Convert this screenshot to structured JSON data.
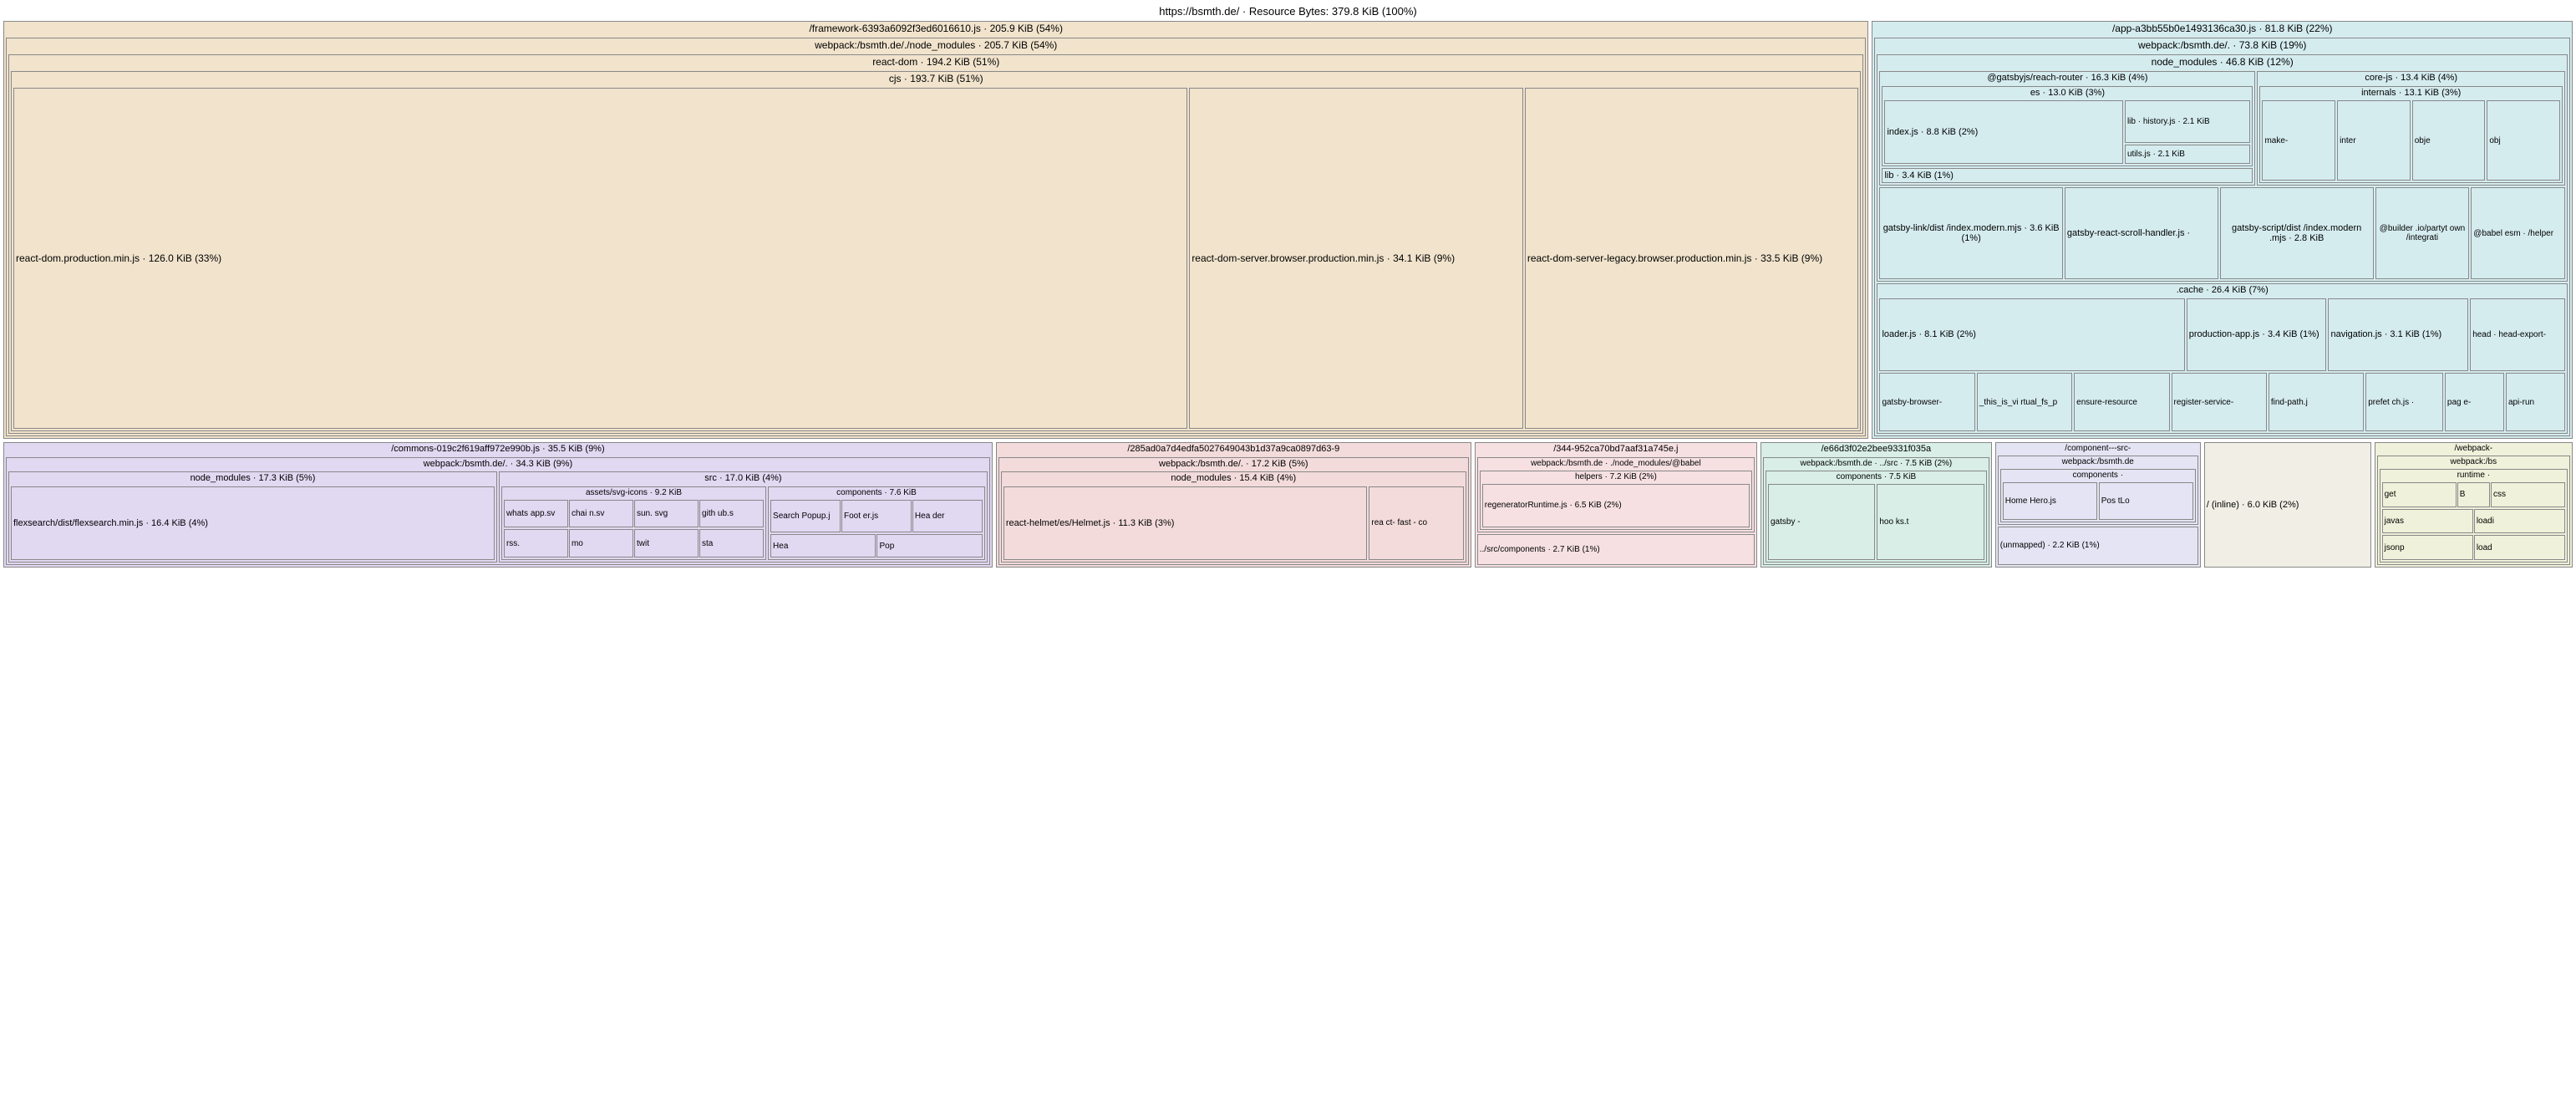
{
  "root_title": "https://bsmth.de/ · Resource Bytes: 379.8 KiB (100%)",
  "framework": {
    "title": "/framework-6393a6092f3ed6016610.js · 205.9 KiB (54%)",
    "webpack": "webpack:/bsmth.de/./node_modules · 205.7 KiB (54%)",
    "react_dom": "react-dom · 194.2 KiB (51%)",
    "cjs": "cjs · 193.7 KiB (51%)",
    "prod_min": "react-dom.production.min.js · 126.0 KiB (33%)",
    "server_browser": "react-dom-server.browser.production.min.js · 34.1 KiB (9%)",
    "server_legacy": "react-dom-server-legacy.browser.production.min.js · 33.5 KiB (9%)"
  },
  "app": {
    "title": "/app-a3bb55b0e1493136ca30.js · 81.8 KiB (22%)",
    "webpack": "webpack:/bsmth.de/. · 73.8 KiB (19%)",
    "node_modules": "node_modules · 46.8 KiB (12%)",
    "reach_router": "@gatsbyjs/reach-router · 16.3 KiB (4%)",
    "es": "es · 13.0 KiB (3%)",
    "index_js": "index.js · 8.8 KiB (2%)",
    "lib_history": "lib · history.js · 2.1 KiB",
    "utils_js": "utils.js · 2.1 KiB",
    "lib": "lib · 3.4 KiB (1%)",
    "core_js": "core-js · 13.4 KiB (4%)",
    "internals": "internals · 13.1 KiB (3%)",
    "make": "make-",
    "inter": "inter",
    "obje": "obje",
    "obj": "obj",
    "gatsby_link": "gatsby-link/dist /index.modern.mjs · 3.6 KiB (1%)",
    "gatsby_scroll": "gatsby-react-scroll-handler.js ·",
    "gatsby_script": "gatsby-script/dist /index.modern .mjs · 2.8 KiB",
    "builder_partytown": "@builder .io/partyt own /integrati",
    "babel_helper": "@babel esm · /helper",
    "cache": ".cache · 26.4 KiB (7%)",
    "loader_js": "loader.js · 8.1 KiB (2%)",
    "production_app": "production-app.js · 3.4 KiB (1%)",
    "navigation": "navigation.js · 3.1 KiB (1%)",
    "head": "head · head-export-",
    "gatsby_browser": "gatsby-browser-",
    "this_is_virtual": "_this_is_vi rtual_fs_p",
    "ensure_resource": "ensure-resource",
    "register_service": "register-service-",
    "find_path": "find-path.j",
    "prefetch": "prefet ch.js ·",
    "page": "pag e-",
    "api_run": "api-run"
  },
  "commons": {
    "title": "/commons-019c2f619aff972e990b.js · 35.5 KiB (9%)",
    "webpack": "webpack:/bsmth.de/. · 34.3 KiB (9%)",
    "node_modules": "node_modules · 17.3 KiB (5%)",
    "flexsearch": "flexsearch/dist/flexsearch.min.js · 16.4 KiB (4%)",
    "src": "src · 17.0 KiB (4%)",
    "svg_icons": "assets/svg-icons · 9.2 KiB",
    "whats": "whats app.sv",
    "chai": "chai n.sv",
    "sun": "sun. svg",
    "gith": "gith ub.s",
    "rss": "rss.",
    "mo": "mo",
    "twit": "twit",
    "sta": "sta",
    "components": "components · 7.6 KiB",
    "search_popup": "Search Popup.j",
    "footer": "Foot er.js",
    "header": "Hea der",
    "hea": "Hea",
    "pop": "Pop"
  },
  "chunk285": {
    "title": "/285ad0a7d4edfa5027649043b1d37a9ca0897d63-9",
    "webpack": "webpack:/bsmth.de/. · 17.2 KiB (5%)",
    "node_modules": "node_modules · 15.4 KiB (4%)",
    "helmet": "react-helmet/es/Helmet.js · 11.3 KiB (3%)",
    "react_fast": "rea ct- fast - co"
  },
  "chunk344": {
    "title": "/344-952ca70bd7aaf31a745e.j",
    "webpack": "webpack:/bsmth.de · ./node_modules/@babel",
    "helpers": "helpers · 7.2 KiB (2%)",
    "regenerator": "regeneratorRuntime.js · 6.5 KiB (2%)",
    "src_components": "../src/components · 2.7 KiB (1%)"
  },
  "chunke66": {
    "title": "/e66d3f02e2bee9331f035a",
    "webpack": "webpack:/bsmth.de · ../src · 7.5 KiB (2%)",
    "components": "components · 7.5 KiB",
    "gatsby": "gatsby -",
    "hooks": "hoo ks.t"
  },
  "component_src": {
    "title": "/component---src-",
    "webpack": "webpack:/bsmth.de",
    "components": "components ·",
    "home_hero": "Home Hero.js",
    "posts": "Pos tLo",
    "unmapped": "(unmapped) · 2.2 KiB (1%)"
  },
  "inline": {
    "title": "/ (inline) · 6.0 KiB (2%)"
  },
  "webpack_runtime": {
    "title": "/webpack-",
    "webpack": "webpack:/bs",
    "runtime": "runtime ·",
    "get": "get",
    "b": "B",
    "css": "css",
    "javas": "javas",
    "loadi": "loadi",
    "jsonp": "jsonp",
    "load": "load"
  }
}
